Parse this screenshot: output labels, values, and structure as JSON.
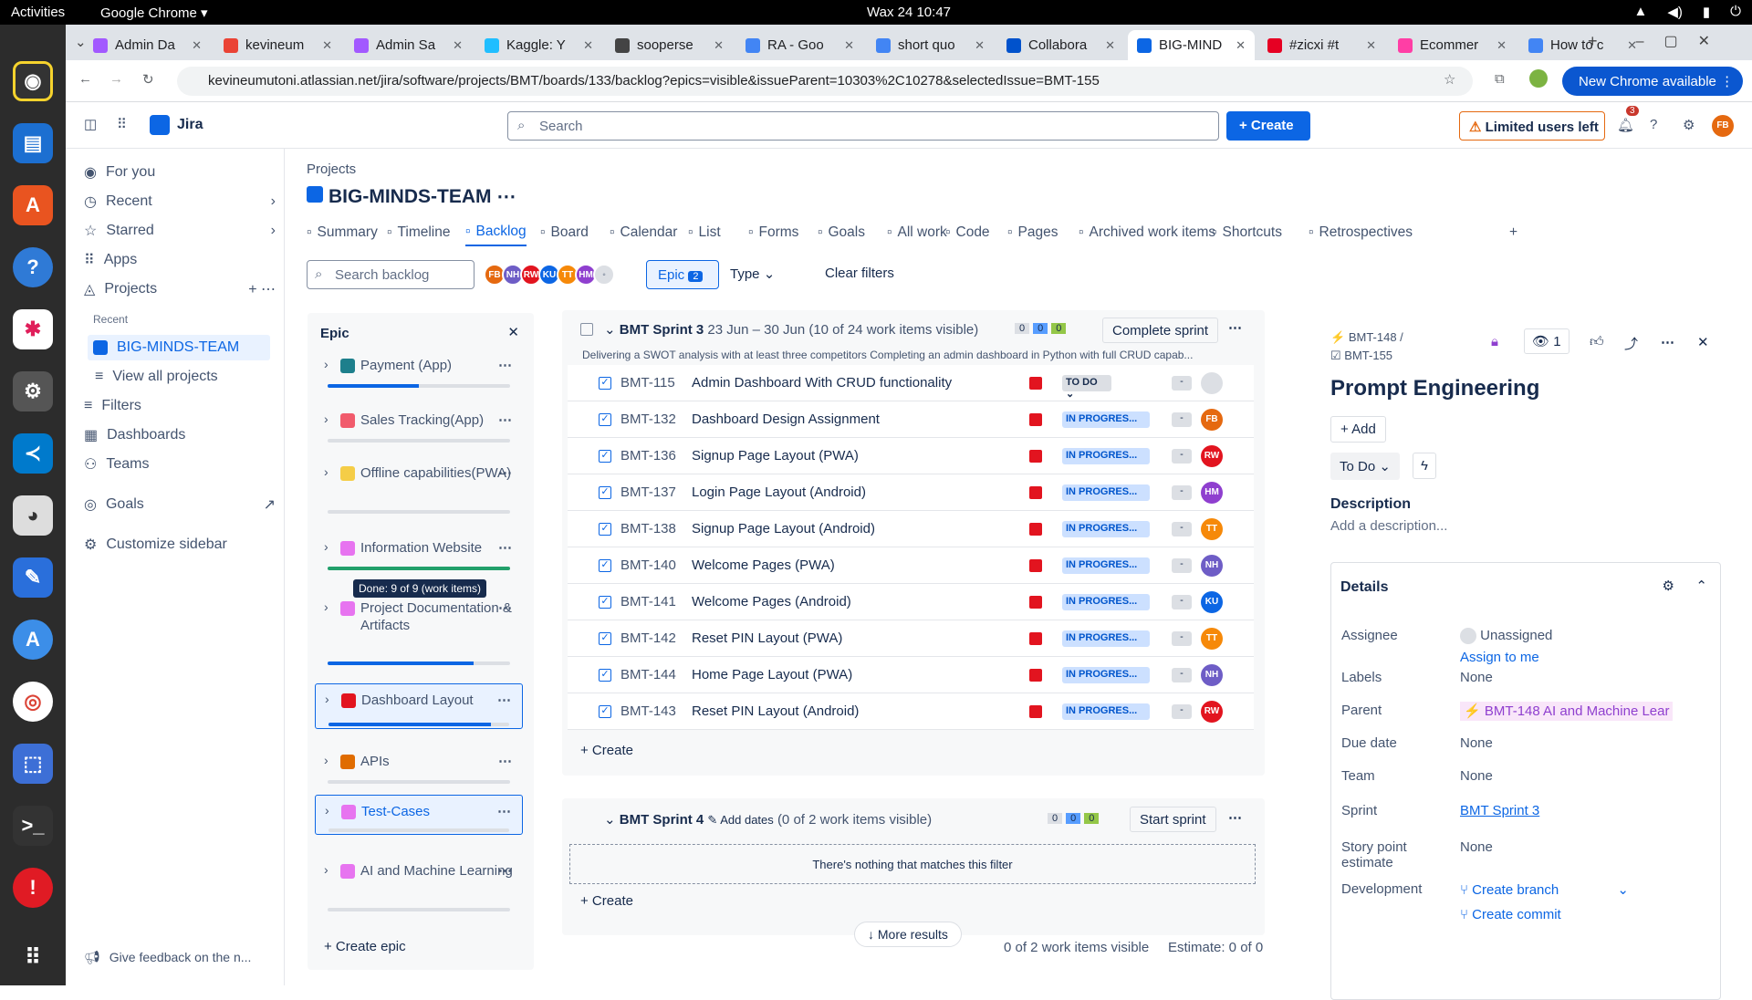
{
  "os": {
    "activities": "Activities",
    "app": "Google Chrome",
    "clock": "Wax 24  10:47"
  },
  "tabs": [
    {
      "label": "Admin Da",
      "color": "#a259ff"
    },
    {
      "label": "kevineum",
      "color": "#ea4335"
    },
    {
      "label": "Admin Sa",
      "color": "#a259ff"
    },
    {
      "label": "Kaggle: Y",
      "color": "#20beff"
    },
    {
      "label": "sooperse",
      "color": "#444"
    },
    {
      "label": "RA - Goo",
      "color": "#4285f4"
    },
    {
      "label": "short quo",
      "color": "#4285f4"
    },
    {
      "label": "Collabora",
      "color": "#0052cc"
    },
    {
      "label": "BIG-MIND",
      "color": "#0c66e4"
    },
    {
      "label": "#zicxi #t",
      "color": "#e60023"
    },
    {
      "label": "Ecommer",
      "color": "#ff3ea5"
    },
    {
      "label": "How to c",
      "color": "#4285f4"
    }
  ],
  "url": "kevineumutoni.atlassian.net/jira/software/projects/BMT/boards/133/backlog?epics=visible&issueParent=10303%2C10278&selectedIssue=BMT-155",
  "new_chrome": "New Chrome available",
  "jira": {
    "brand": "Jira",
    "search_placeholder": "Search",
    "create": "+ Create",
    "limited": "Limited users left",
    "notif": "3",
    "me": "FB"
  },
  "sidebar": {
    "for_you": "For you",
    "recent": "Recent",
    "starred": "Starred",
    "apps": "Apps",
    "projects": "Projects",
    "recent_label": "Recent",
    "project": "BIG-MINDS-TEAM",
    "view_all": "View all projects",
    "filters": "Filters",
    "dashboards": "Dashboards",
    "teams": "Teams",
    "goals": "Goals",
    "customize": "Customize sidebar",
    "feedback": "Give feedback on the n..."
  },
  "project": {
    "crumb": "Projects",
    "title": "BIG-MINDS-TEAM"
  },
  "navtabs": [
    "Summary",
    "Timeline",
    "Backlog",
    "Board",
    "Calendar",
    "List",
    "Forms",
    "Goals",
    "All work",
    "Code",
    "Pages",
    "Archived work items",
    "Shortcuts",
    "Retrospectives"
  ],
  "filters": {
    "search": "Search backlog",
    "epic": "Epic",
    "epic_count": "2",
    "type": "Type",
    "clear": "Clear filters",
    "avatars": [
      {
        "i": "FB",
        "c": "#e56910"
      },
      {
        "i": "NH",
        "c": "#6e5dc6"
      },
      {
        "i": "RW",
        "c": "#e2141f"
      },
      {
        "i": "KU",
        "c": "#0c66e4"
      },
      {
        "i": "TT",
        "c": "#f68909"
      },
      {
        "i": "HM",
        "c": "#8f3fcf"
      }
    ]
  },
  "epic_panel": {
    "title": "Epic",
    "create": "+ Create epic",
    "tooltip": "Done: 9 of 9 (work items)",
    "epics": [
      {
        "name": "Payment (App)",
        "color": "#1d7f8c",
        "progress": 0.5
      },
      {
        "name": "Sales Tracking(App)",
        "color": "#f15b6c",
        "progress": 0
      },
      {
        "name": "Offline capabilities(PWA)",
        "color": "#f5cd47",
        "progress": 0
      },
      {
        "name": "Information Website",
        "color": "#e774f0",
        "progress": 1.0
      },
      {
        "name": "Project Documentation & Artifacts",
        "color": "#e774f0",
        "progress": 0.8
      },
      {
        "name": "Dashboard Layout",
        "color": "#e2141f",
        "progress": 0.9
      },
      {
        "name": "APIs",
        "color": "#e06c00",
        "progress": 0
      },
      {
        "name": "Test-Cases",
        "color": "#e774f0",
        "progress": 0
      },
      {
        "name": "AI and Machine Learning",
        "color": "#e774f0",
        "progress": 0
      }
    ]
  },
  "sprint3": {
    "name": "BMT Sprint 3",
    "dates": "23 Jun – 30 Jun (10 of 24 work items visible)",
    "c0": "0",
    "c1": "0",
    "c2": "0",
    "action": "Complete sprint",
    "goal": "Delivering a SWOT analysis with at least three competitors Completing an admin dashboard in Python with full CRUD capab...",
    "create": "+ Create",
    "rows": [
      {
        "key": "BMT-115",
        "summary": "Admin Dashboard With CRUD functionality",
        "status": "TO DO",
        "assignee": "",
        "color": "#dcdfe4"
      },
      {
        "key": "BMT-132",
        "summary": "Dashboard Design Assignment",
        "status": "IN PROGRES...",
        "assignee": "FB",
        "color": "#e56910"
      },
      {
        "key": "BMT-136",
        "summary": "Signup Page Layout (PWA)",
        "status": "IN PROGRES...",
        "assignee": "RW",
        "color": "#e2141f"
      },
      {
        "key": "BMT-137",
        "summary": "Login Page Layout (Android)",
        "status": "IN PROGRES...",
        "assignee": "HM",
        "color": "#8f3fcf"
      },
      {
        "key": "BMT-138",
        "summary": "Signup Page Layout (Android)",
        "status": "IN PROGRES...",
        "assignee": "TT",
        "color": "#f68909"
      },
      {
        "key": "BMT-140",
        "summary": "Welcome Pages (PWA)",
        "status": "IN PROGRES...",
        "assignee": "NH",
        "color": "#6e5dc6"
      },
      {
        "key": "BMT-141",
        "summary": "Welcome Pages (Android)",
        "status": "IN PROGRES...",
        "assignee": "KU",
        "color": "#0c66e4"
      },
      {
        "key": "BMT-142",
        "summary": "Reset PIN Layout (PWA)",
        "status": "IN PROGRES...",
        "assignee": "TT",
        "color": "#f68909"
      },
      {
        "key": "BMT-144",
        "summary": "Home Page Layout (PWA)",
        "status": "IN PROGRES...",
        "assignee": "NH",
        "color": "#6e5dc6"
      },
      {
        "key": "BMT-143",
        "summary": "Reset PIN Layout (Android)",
        "status": "IN PROGRES...",
        "assignee": "RW",
        "color": "#e2141f"
      }
    ]
  },
  "sprint4": {
    "name": "BMT Sprint 4",
    "add_dates": "Add dates",
    "visible": "(0 of 2 work items visible)",
    "c0": "0",
    "c1": "0",
    "c2": "0",
    "action": "Start sprint",
    "empty": "There's nothing that matches this filter",
    "create": "+ Create",
    "more": "More results",
    "footer_visible": "0 of 2 work items visible",
    "estimate": "Estimate: 0 of 0"
  },
  "detail": {
    "parent_key": "BMT-148",
    "key": "BMT-155",
    "watch": "1",
    "title": "Prompt Engineering",
    "add": "+ Add",
    "status": "To Do",
    "desc_label": "Description",
    "desc_placeholder": "Add a description...",
    "details": "Details",
    "fields": [
      {
        "label": "Assignee",
        "value": "Unassigned"
      },
      {
        "label": "Labels",
        "value": "None"
      },
      {
        "label": "Parent",
        "value": "BMT-148 AI and Machine Lear"
      },
      {
        "label": "Due date",
        "value": "None"
      },
      {
        "label": "Team",
        "value": "None"
      },
      {
        "label": "Sprint",
        "value": "BMT Sprint 3"
      },
      {
        "label": "Story point estimate",
        "value": "None"
      },
      {
        "label": "Development",
        "value": "Create branch"
      }
    ],
    "assign_me": "Assign to me",
    "create_commit": "Create commit"
  }
}
